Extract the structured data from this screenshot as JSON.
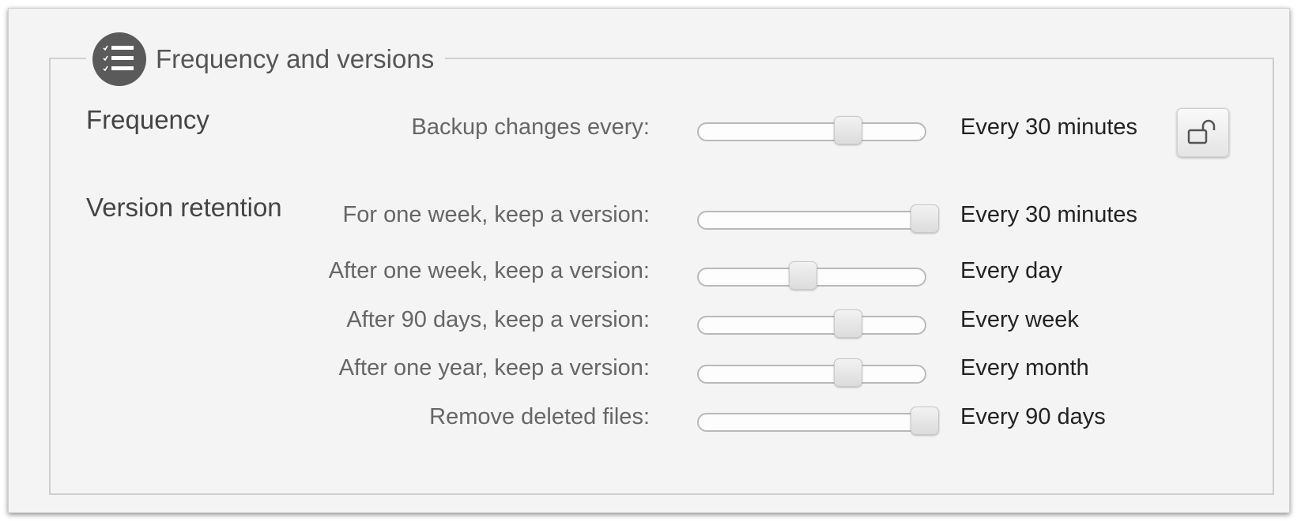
{
  "section": {
    "title": "Frequency and versions",
    "icon": "checklist-icon"
  },
  "frequency": {
    "heading": "Frequency",
    "row": {
      "label": "Backup changes every:",
      "value": "Every 30 minutes",
      "position": 0.66
    },
    "lock_icon": "unlocked-padlock-icon"
  },
  "retention": {
    "heading": "Version retention",
    "rows": [
      {
        "label": "For one week, keep a version:",
        "value": "Every 30 minutes",
        "position": 1.0
      },
      {
        "label": "After one week, keep a version:",
        "value": "Every day",
        "position": 0.46
      },
      {
        "label": "After 90 days, keep a version:",
        "value": "Every week",
        "position": 0.66
      },
      {
        "label": "After one year, keep a version:",
        "value": "Every month",
        "position": 0.66
      },
      {
        "label": "Remove deleted files:",
        "value": "Every 90 days",
        "position": 1.0
      }
    ]
  }
}
